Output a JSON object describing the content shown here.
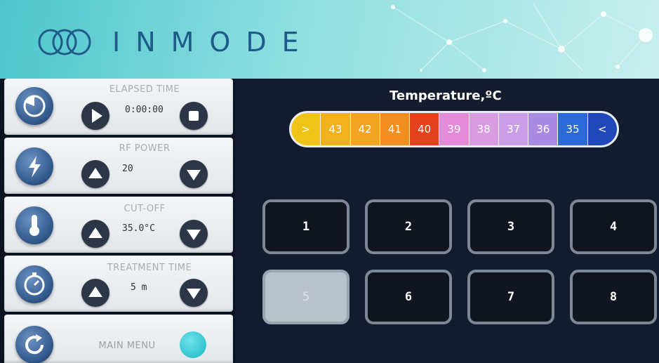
{
  "header": {
    "brand": "INMODE"
  },
  "controls": {
    "elapsed_time": {
      "label": "ELAPSED TIME",
      "value": "0:00:00"
    },
    "rf_power": {
      "label": "RF POWER",
      "value": "20"
    },
    "cut_off": {
      "label": "CUT-OFF",
      "value": "35.0°C"
    },
    "treatment_time": {
      "label": "TREATMENT TIME",
      "value": "5 m"
    },
    "main_menu": {
      "label": "MAIN MENU"
    }
  },
  "temperature": {
    "title": "Temperature,ºC",
    "segments": [
      {
        "label": ">",
        "color": "#f0c417"
      },
      {
        "label": "43",
        "color": "#f2b21c"
      },
      {
        "label": "42",
        "color": "#f3a422"
      },
      {
        "label": "41",
        "color": "#f28e1f"
      },
      {
        "label": "40",
        "color": "#e4421e"
      },
      {
        "label": "39",
        "color": "#e48ad8"
      },
      {
        "label": "38",
        "color": "#d99be0"
      },
      {
        "label": "37",
        "color": "#c99ee6"
      },
      {
        "label": "36",
        "color": "#a98ae2"
      },
      {
        "label": "35",
        "color": "#2a69d6"
      },
      {
        "label": "<",
        "color": "#2048b8"
      }
    ]
  },
  "grid": {
    "selected": "5",
    "buttons": [
      "1",
      "2",
      "3",
      "4",
      "5",
      "6",
      "7",
      "8"
    ]
  }
}
